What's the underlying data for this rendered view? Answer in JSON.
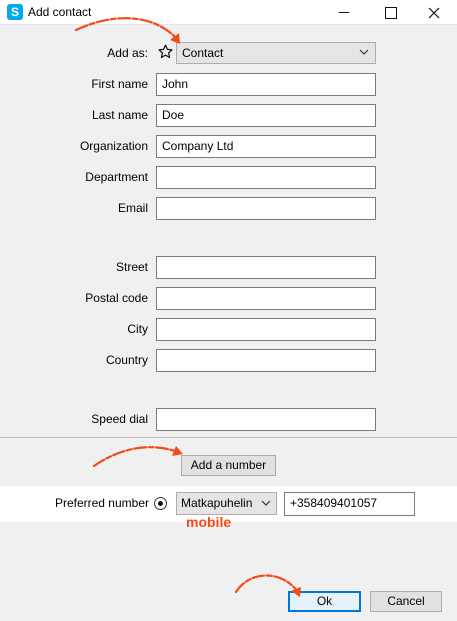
{
  "window": {
    "app_icon_letter": "S",
    "title": "Add contact"
  },
  "form": {
    "add_as_label": "Add as:",
    "add_as_value": "Contact",
    "first_name_label": "First name",
    "first_name_value": "John",
    "last_name_label": "Last name",
    "last_name_value": "Doe",
    "organization_label": "Organization",
    "organization_value": "Company Ltd",
    "department_label": "Department",
    "department_value": "",
    "email_label": "Email",
    "email_value": "",
    "street_label": "Street",
    "street_value": "",
    "postal_code_label": "Postal code",
    "postal_code_value": "",
    "city_label": "City",
    "city_value": "",
    "country_label": "Country",
    "country_value": "",
    "speed_dial_label": "Speed dial",
    "speed_dial_value": ""
  },
  "numbers": {
    "add_button_label": "Add a number",
    "preferred_label": "Preferred number",
    "type_value": "Matkapuhelin",
    "number_value": "+358409401057"
  },
  "annotation": {
    "mobile_text": "mobile",
    "color": "#f44a1a"
  },
  "footer": {
    "ok_label": "Ok",
    "cancel_label": "Cancel"
  }
}
